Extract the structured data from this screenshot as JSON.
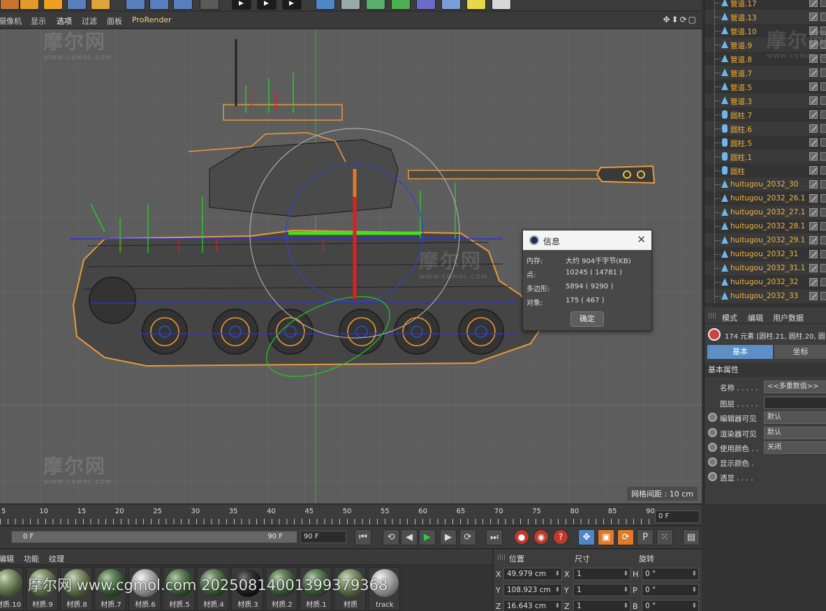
{
  "viewport_menu": {
    "items": [
      "摄像机",
      "显示",
      "选项",
      "过滤",
      "面板",
      "ProRender"
    ]
  },
  "viewport": {
    "grid_label": "网格间距 : 10 cm"
  },
  "watermark": {
    "brand": "摩尔网",
    "site": "WWW.CGMOL.COM",
    "bottom": "摩尔网 www.cgmol.com 20250814001399379368"
  },
  "info_dialog": {
    "title": "信息",
    "rows": [
      {
        "label": "内存:",
        "value": "大约 904千字节(KB)"
      },
      {
        "label": "点:",
        "value": "10245 ( 14781 )"
      },
      {
        "label": "多边形:",
        "value": "5894 ( 9290 )"
      },
      {
        "label": "对象:",
        "value": "175 ( 467 )"
      }
    ],
    "ok_label": "确定"
  },
  "object_list": {
    "items": [
      {
        "name": "管道.17",
        "type": "tube"
      },
      {
        "name": "管道.13",
        "type": "tube"
      },
      {
        "name": "管道.10",
        "type": "tube"
      },
      {
        "name": "管道.9",
        "type": "tube"
      },
      {
        "name": "管道.8",
        "type": "tube"
      },
      {
        "name": "管道.7",
        "type": "tube"
      },
      {
        "name": "管道.5",
        "type": "tube"
      },
      {
        "name": "管道.3",
        "type": "tube"
      },
      {
        "name": "圆柱.7",
        "type": "cylinder"
      },
      {
        "name": "圆柱.6",
        "type": "cylinder"
      },
      {
        "name": "圆柱.5",
        "type": "cylinder"
      },
      {
        "name": "圆柱.1",
        "type": "cylinder"
      },
      {
        "name": "圆柱",
        "type": "cylinder"
      },
      {
        "name": "huitugou_2032_30",
        "type": "tube"
      },
      {
        "name": "huitugou_2032_26.1",
        "type": "tube"
      },
      {
        "name": "huitugou_2032_27.1",
        "type": "tube"
      },
      {
        "name": "huitugou_2032_28.1",
        "type": "tube"
      },
      {
        "name": "huitugou_2032_29.1",
        "type": "tube"
      },
      {
        "name": "huitugou_2032_31",
        "type": "tube"
      },
      {
        "name": "huitugou_2032_31.1",
        "type": "tube"
      },
      {
        "name": "huitugou_2032_32",
        "type": "tube"
      },
      {
        "name": "huitugou_2032_33",
        "type": "tube"
      }
    ]
  },
  "attributes": {
    "tabs": [
      "模式",
      "编辑",
      "用户数据"
    ],
    "info": "174 元素 [圆柱.21, 圆柱.20, 圆",
    "segments": [
      "基本",
      "坐标"
    ],
    "section": "基本属性",
    "rows": [
      {
        "label": "名称 . . . . .",
        "value": "<<多重数值>>",
        "radio": false
      },
      {
        "label": "图层 . . . . .",
        "value": "",
        "radio": false
      },
      {
        "label": "编辑器可见",
        "value": "默认",
        "radio": true
      },
      {
        "label": "渲染器可见",
        "value": "默认",
        "radio": true
      },
      {
        "label": "使用颜色 . .",
        "value": "关闭",
        "radio": true
      },
      {
        "label": "显示颜色 .",
        "value": "",
        "radio": true
      },
      {
        "label": "透显 . . . .",
        "value": "",
        "radio": true
      }
    ]
  },
  "timeline": {
    "ticks": [
      "5",
      "10",
      "15",
      "20",
      "25",
      "30",
      "35",
      "40",
      "45",
      "50",
      "55",
      "60",
      "65",
      "70",
      "75",
      "80",
      "85",
      "90"
    ],
    "current_frame": "0 F"
  },
  "transport": {
    "range_start": "0 F",
    "range_end": "90 F",
    "end_frame": "90 F"
  },
  "materials": {
    "menu": [
      "编辑",
      "功能",
      "纹理"
    ],
    "items": [
      {
        "name": "材质.10",
        "look": "olive"
      },
      {
        "name": "材质.9",
        "look": "olive"
      },
      {
        "name": "材质.8",
        "look": "olive"
      },
      {
        "name": "材质.7",
        "look": "dgreen"
      },
      {
        "name": "材质.6",
        "look": "gray"
      },
      {
        "name": "材质.5",
        "look": "dgreen"
      },
      {
        "name": "材质.4",
        "look": "dgreen"
      },
      {
        "name": "材质.3",
        "look": "black"
      },
      {
        "name": "材质.2",
        "look": "dgreen"
      },
      {
        "name": "材质.1",
        "look": "dgreen"
      },
      {
        "name": "材质",
        "look": "olive"
      },
      {
        "name": "track",
        "look": "gray"
      }
    ]
  },
  "coordinates": {
    "headers": [
      "位置",
      "尺寸",
      "旋转"
    ],
    "rows": [
      {
        "axis": "X",
        "pos": "49.979 cm",
        "size_axis": "X",
        "size": "1",
        "rot_axis": "H",
        "rot": "0 °"
      },
      {
        "axis": "Y",
        "pos": "108.923 cm",
        "size_axis": "Y",
        "size": "1",
        "rot_axis": "P",
        "rot": "0 °"
      },
      {
        "axis": "Z",
        "pos": "16.643 cm",
        "size_axis": "Z",
        "size": "1",
        "rot_axis": "B",
        "rot": "0 °"
      }
    ]
  }
}
